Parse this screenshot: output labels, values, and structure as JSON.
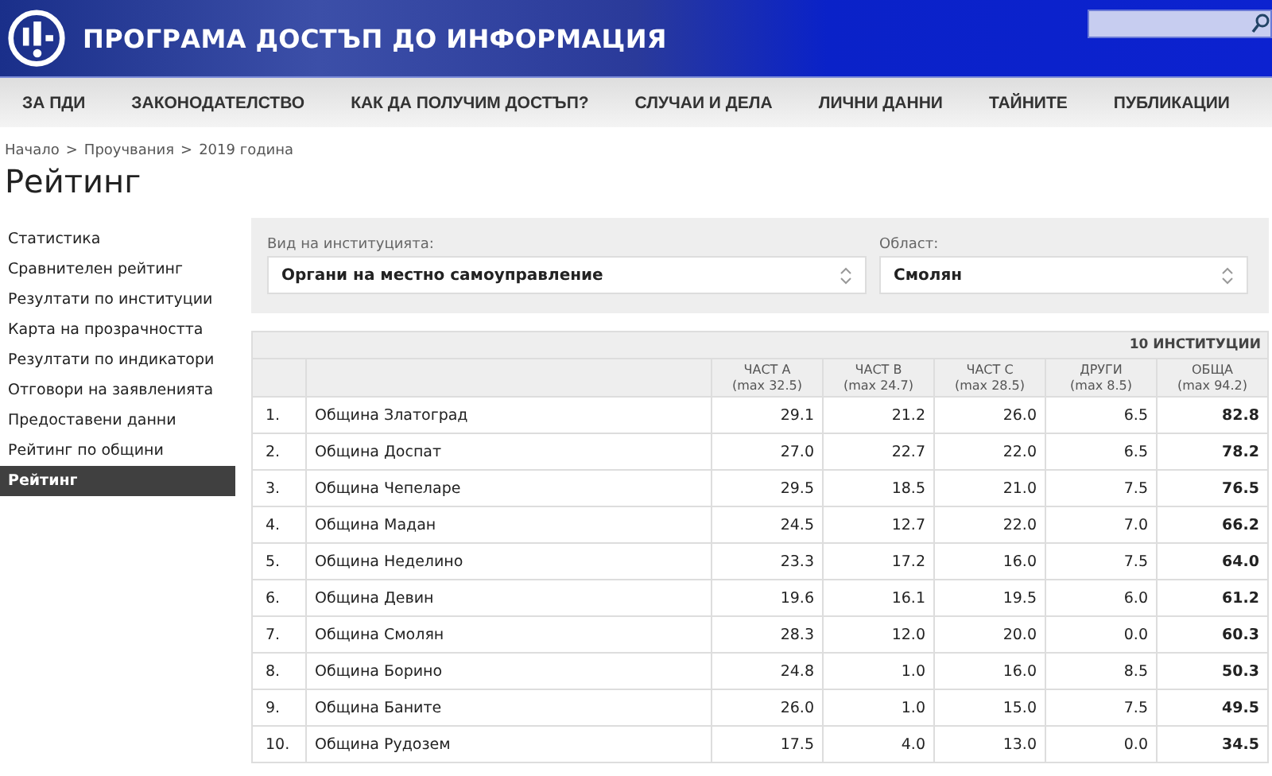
{
  "header": {
    "title": "ПРОГРАМА ДОСТЪП ДО ИНФОРМАЦИЯ"
  },
  "nav": [
    "ЗА ПДИ",
    "ЗАКОНОДАТЕЛСТВО",
    "КАК ДА ПОЛУЧИМ ДОСТЪП?",
    "СЛУЧАИ И ДЕЛА",
    "ЛИЧНИ ДАННИ",
    "ТАЙНИТЕ",
    "ПУБЛИКАЦИИ"
  ],
  "breadcrumb": [
    "Начало",
    ">",
    "Проучвания",
    ">",
    "2019 година"
  ],
  "page_title": "Рейтинг",
  "sidebar": {
    "items": [
      {
        "label": "Статистика",
        "selected": false
      },
      {
        "label": "Сравнителен рейтинг",
        "selected": false
      },
      {
        "label": "Резултати по институции",
        "selected": false
      },
      {
        "label": "Карта на прозрачността",
        "selected": false
      },
      {
        "label": "Резултати по индикатори",
        "selected": false
      },
      {
        "label": "Отговори на заявленията",
        "selected": false
      },
      {
        "label": "Предоставени данни",
        "selected": false
      },
      {
        "label": "Рейтинг по общини",
        "selected": false
      },
      {
        "label": "Рейтинг",
        "selected": true
      }
    ]
  },
  "filters": [
    {
      "label": "Вид на институцията:",
      "value": "Органи на местно самоуправление"
    },
    {
      "label": "Област:",
      "value": "Смолян"
    }
  ],
  "table": {
    "count": "10 ИНСТИТУЦИИ",
    "columns": [
      {},
      {},
      {
        "title": "ЧАСТ А",
        "sub": "(max 32.5)"
      },
      {
        "title": "ЧАСТ B",
        "sub": "(max 24.7)"
      },
      {
        "title": "ЧАСТ C",
        "sub": "(max 28.5)"
      },
      {
        "title": "ДРУГИ",
        "sub": "(max 8.5)"
      },
      {
        "title": "ОБЩА",
        "sub": "(max 94.2)"
      }
    ],
    "rows": [
      [
        "1.",
        "Община Златоград",
        "29.1",
        "21.2",
        "26.0",
        "6.5",
        "82.8"
      ],
      [
        "2.",
        "Община Доспат",
        "27.0",
        "22.7",
        "22.0",
        "6.5",
        "78.2"
      ],
      [
        "3.",
        "Община Чепеларе",
        "29.5",
        "18.5",
        "21.0",
        "7.5",
        "76.5"
      ],
      [
        "4.",
        "Община Мадан",
        "24.5",
        "12.7",
        "22.0",
        "7.0",
        "66.2"
      ],
      [
        "5.",
        "Община Неделино",
        "23.3",
        "17.2",
        "16.0",
        "7.5",
        "64.0"
      ],
      [
        "6.",
        "Община Девин",
        "19.6",
        "16.1",
        "19.5",
        "6.0",
        "61.2"
      ],
      [
        "7.",
        "Община Смолян",
        "28.3",
        "12.0",
        "20.0",
        "0.0",
        "60.3"
      ],
      [
        "8.",
        "Община Борино",
        "24.8",
        "1.0",
        "16.0",
        "8.5",
        "50.3"
      ],
      [
        "9.",
        "Община Баните",
        "26.0",
        "1.0",
        "15.0",
        "7.5",
        "49.5"
      ],
      [
        "10.",
        "Община Рудозем",
        "17.5",
        "4.0",
        "13.0",
        "0.0",
        "34.5"
      ]
    ]
  }
}
